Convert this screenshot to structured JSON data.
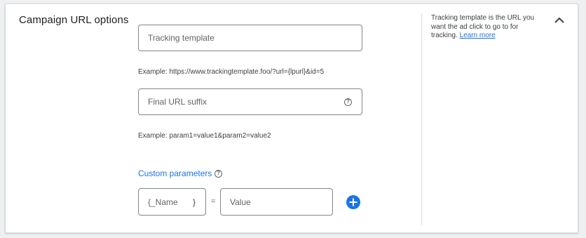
{
  "section": {
    "title": "Campaign URL options"
  },
  "tracking_template": {
    "placeholder": "Tracking template",
    "example": "Example: https://www.trackingtemplate.foo/?url={lpurl}&id=5"
  },
  "final_url_suffix": {
    "placeholder": "Final URL suffix",
    "example": "Example: param1=value1&param2=value2"
  },
  "custom_parameters": {
    "label": "Custom parameters",
    "name_placeholder": "{_Name",
    "name_close_brace": "}",
    "equals": "=",
    "value_placeholder": "Value"
  },
  "side_panel": {
    "help_text": "Tracking template is the URL you want the ad click to go to for tracking.",
    "learn_more": "Learn more"
  },
  "icons": {
    "help": "help-circle-icon",
    "add": "add-circle-icon",
    "collapse": "chevron-up-icon"
  },
  "colors": {
    "accent": "#1a73e8"
  }
}
